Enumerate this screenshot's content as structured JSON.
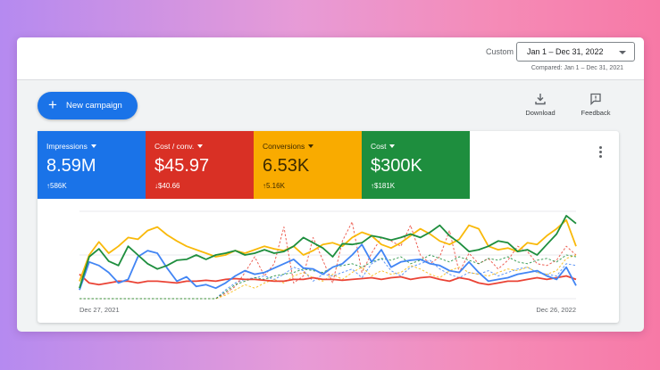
{
  "header": {
    "custom_label": "Custom",
    "date_range": "Jan 1 – Dec 31, 2022",
    "compared": "Compared: Jan 1 – Dec 31, 2021"
  },
  "toolbar": {
    "new_campaign": "New campaign",
    "download": "Download",
    "feedback": "Feedback"
  },
  "metrics": [
    {
      "label": "Impressions",
      "value": "8.59M",
      "delta": "586K",
      "direction": "up",
      "color": "#1a73e8"
    },
    {
      "label": "Cost / conv.",
      "value": "$45.97",
      "delta": "$40.66",
      "direction": "down",
      "color": "#d93025"
    },
    {
      "label": "Conversions",
      "value": "6.53K",
      "delta": "5.16K",
      "direction": "up",
      "color": "#f9ab00"
    },
    {
      "label": "Cost",
      "value": "$300K",
      "delta": "$181K",
      "direction": "up",
      "color": "#1e8e3e"
    }
  ],
  "chart_data": {
    "type": "line",
    "x_start": "Dec 27, 2021",
    "x_end": "Dec 26, 2022",
    "ylim": [
      0,
      100
    ],
    "grid": true,
    "series": [
      {
        "metric": "Impressions",
        "period": "current",
        "style": "solid",
        "color": "#4285f4",
        "values": [
          10,
          42,
          38,
          30,
          18,
          22,
          48,
          55,
          52,
          35,
          20,
          25,
          14,
          16,
          12,
          18,
          26,
          32,
          28,
          30,
          35,
          40,
          45,
          35,
          34,
          28,
          36,
          40,
          50,
          62,
          42,
          56,
          36,
          42,
          44,
          45,
          40,
          38,
          32,
          30,
          42,
          30,
          20,
          22,
          24,
          28,
          30,
          32,
          26,
          22,
          36,
          15
        ]
      },
      {
        "metric": "Cost / conv.",
        "period": "current",
        "style": "solid",
        "color": "#ea4335",
        "values": [
          28,
          18,
          16,
          18,
          20,
          20,
          18,
          20,
          20,
          19,
          18,
          20,
          20,
          21,
          20,
          22,
          23,
          22,
          22,
          21,
          20,
          20,
          22,
          22,
          24,
          22,
          22,
          21,
          22,
          23,
          24,
          22,
          24,
          25,
          22,
          24,
          25,
          22,
          20,
          24,
          22,
          18,
          16,
          18,
          20,
          20,
          22,
          24,
          22,
          24,
          26,
          22
        ]
      },
      {
        "metric": "Conversions",
        "period": "current",
        "style": "solid",
        "color": "#f9b90a",
        "values": [
          20,
          50,
          65,
          52,
          60,
          70,
          68,
          78,
          82,
          73,
          66,
          60,
          56,
          52,
          48,
          50,
          55,
          52,
          56,
          60,
          57,
          55,
          60,
          50,
          55,
          62,
          64,
          60,
          70,
          76,
          72,
          62,
          58,
          64,
          72,
          80,
          74,
          66,
          62,
          68,
          84,
          80,
          60,
          56,
          58,
          54,
          64,
          62,
          72,
          80,
          90,
          60
        ]
      },
      {
        "metric": "Cost",
        "period": "current",
        "style": "solid",
        "color": "#1e8e3e",
        "values": [
          12,
          48,
          57,
          43,
          38,
          60,
          50,
          40,
          34,
          38,
          44,
          45,
          50,
          45,
          50,
          52,
          55,
          50,
          52,
          56,
          52,
          54,
          60,
          70,
          64,
          58,
          48,
          63,
          62,
          64,
          72,
          70,
          67,
          70,
          74,
          70,
          76,
          84,
          72,
          64,
          54,
          56,
          60,
          66,
          64,
          54,
          56,
          50,
          62,
          74,
          95,
          86
        ]
      },
      {
        "metric": "Impressions",
        "period": "previous",
        "style": "dashed",
        "color": "#4285f4",
        "values": [
          0,
          0,
          0,
          0,
          0,
          0,
          0,
          0,
          0,
          0,
          0,
          0,
          0,
          0,
          0,
          10,
          18,
          22,
          24,
          26,
          22,
          28,
          36,
          32,
          20,
          28,
          26,
          30,
          34,
          24,
          40,
          46,
          32,
          26,
          36,
          40,
          44,
          34,
          28,
          24,
          30,
          28,
          32,
          26,
          30,
          34,
          36,
          30,
          28,
          26,
          40,
          38
        ]
      },
      {
        "metric": "Cost / conv.",
        "period": "previous",
        "style": "dashed",
        "color": "#ea4335",
        "values": [
          0,
          0,
          0,
          0,
          0,
          0,
          0,
          0,
          0,
          0,
          0,
          0,
          0,
          0,
          0,
          6,
          14,
          30,
          48,
          26,
          40,
          82,
          18,
          26,
          70,
          44,
          18,
          66,
          88,
          30,
          52,
          70,
          66,
          60,
          84,
          50,
          40,
          48,
          78,
          30,
          52,
          40,
          46,
          34,
          44,
          60,
          54,
          40,
          38,
          44,
          60,
          50
        ]
      },
      {
        "metric": "Conversions",
        "period": "previous",
        "style": "dashed",
        "color": "#f9b90a",
        "values": [
          0,
          0,
          0,
          0,
          0,
          0,
          0,
          0,
          0,
          0,
          0,
          0,
          0,
          0,
          0,
          4,
          10,
          16,
          12,
          18,
          22,
          18,
          26,
          30,
          24,
          20,
          28,
          22,
          30,
          36,
          26,
          32,
          28,
          30,
          38,
          34,
          28,
          24,
          32,
          36,
          30,
          28,
          26,
          30,
          34,
          32,
          36,
          30,
          28,
          32,
          46,
          50
        ]
      },
      {
        "metric": "Cost",
        "period": "previous",
        "style": "dashed",
        "color": "#1e8e3e",
        "values": [
          0,
          0,
          0,
          0,
          0,
          0,
          0,
          0,
          0,
          0,
          0,
          0,
          0,
          0,
          0,
          8,
          16,
          20,
          24,
          22,
          26,
          28,
          30,
          34,
          32,
          30,
          36,
          38,
          40,
          36,
          42,
          46,
          44,
          48,
          40,
          44,
          50,
          46,
          42,
          48,
          44,
          40,
          46,
          44,
          48,
          42,
          40,
          44,
          46,
          42,
          50,
          48
        ]
      }
    ]
  }
}
